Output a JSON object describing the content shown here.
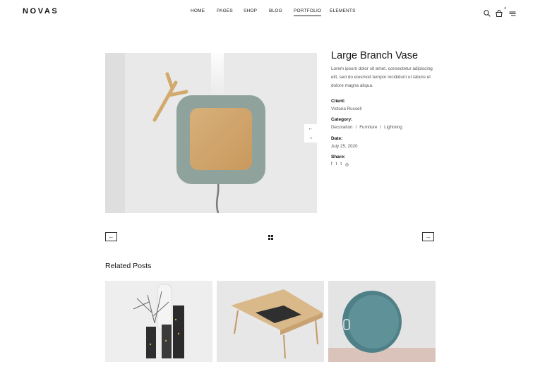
{
  "header": {
    "logo": "NOVAS",
    "nav": [
      "HOME",
      "PAGES",
      "SHOP",
      "BLOG",
      "PORTFOLIO",
      "ELEMENTS"
    ],
    "active_nav": "PORTFOLIO",
    "cart_count": "0",
    "icons": [
      "search-icon",
      "cart-icon",
      "menu-icon"
    ]
  },
  "project": {
    "title": "Large Branch Vase",
    "description": "Lorem ipsum dolor sit amet, consectetur adipiscing elit, sed do eiusmod tempor incididunt ut labore et dolore magna aliqua.",
    "client_label": "Client:",
    "client": "Victoria Russell",
    "category_label": "Category:",
    "categories": [
      "Decoration",
      "Furniture",
      "Lightning"
    ],
    "date_label": "Date:",
    "date": "July 25, 2020",
    "share_label": "Share:",
    "share_icons": [
      "f",
      "t",
      "t",
      "◎"
    ]
  },
  "slider": {
    "prev": "←",
    "next": "→"
  },
  "pager": {
    "prev": "←",
    "next": "→"
  },
  "related": {
    "title": "Related Posts"
  },
  "colors": {
    "accent": "#222222",
    "text_muted": "#555555",
    "tray": "#5f8e93",
    "device": "#8fa39c"
  }
}
